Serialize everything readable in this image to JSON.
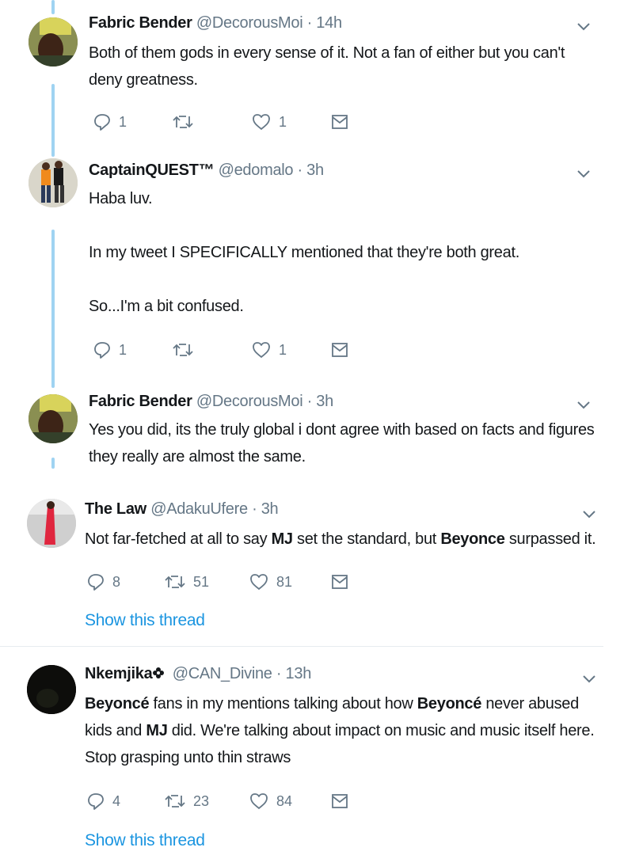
{
  "tweets": [
    {
      "name": "Fabric Bender",
      "handle": "@DecorousMoi",
      "time": "14h",
      "text": [
        "Both of them gods in every sense of it. Not a fan of either but you can't deny greatness."
      ],
      "reply_count": "1",
      "retweet_count": "",
      "like_count": "1"
    },
    {
      "name": "CaptainQUEST™",
      "handle": "@edomalo",
      "time": "3h",
      "text": [
        "Haba luv.",
        "In my tweet I SPECIFICALLY mentioned that they're both great.",
        "So...I'm a bit confused."
      ],
      "reply_count": "1",
      "retweet_count": "",
      "like_count": "1"
    },
    {
      "name": "Fabric Bender",
      "handle": "@DecorousMoi",
      "time": "3h",
      "text": [
        "Yes you did, its the truly global i dont agree with based on facts and figures they really are almost the same."
      ]
    },
    {
      "name": "The Law",
      "handle": "@AdakuUfere",
      "time": "3h",
      "text_parts": [
        "Not far-fetched at all to say ",
        "MJ",
        " set the standard, but ",
        "Beyonce",
        " surpassed it."
      ],
      "reply_count": "8",
      "retweet_count": "51",
      "like_count": "81",
      "show_thread": "Show this thread"
    },
    {
      "name": "Nkemjika",
      "handle": "@CAN_Divine",
      "time": "13h",
      "text_parts": [
        "Beyoncé",
        " fans in my mentions talking about how ",
        "Beyoncé",
        " never abused kids and ",
        "MJ",
        " did. We're talking about impact on music and music itself here. Stop grasping unto thin straws"
      ],
      "reply_count": "4",
      "retweet_count": "23",
      "like_count": "84",
      "show_thread": "Show this thread"
    }
  ],
  "separator": "·",
  "colors": {
    "thread_line": "#9fd3f2",
    "link": "#1b95e0",
    "muted": "#657786"
  }
}
